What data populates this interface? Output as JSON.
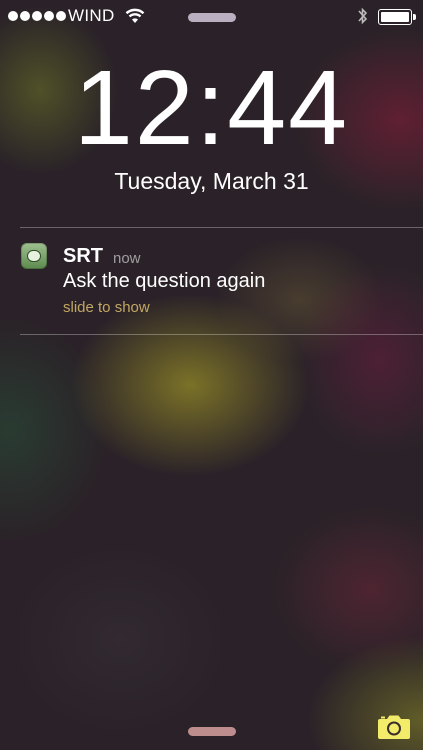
{
  "status_bar": {
    "carrier": "WIND",
    "signal_bars": 5,
    "wifi_icon": "wifi-icon",
    "bluetooth_icon": "bluetooth-icon",
    "battery_level": 1.0
  },
  "lock_screen": {
    "time": "12:44",
    "date": "Tuesday, March 31"
  },
  "notification": {
    "app_icon": "srt-app-icon",
    "app_name": "SRT",
    "time_ago": "now",
    "message": "Ask the question again",
    "action_hint": "slide to show"
  },
  "bottom": {
    "camera_icon": "camera-icon"
  },
  "colors": {
    "slide_hint": "#d8bc6e",
    "camera": "#f3ec6a"
  }
}
